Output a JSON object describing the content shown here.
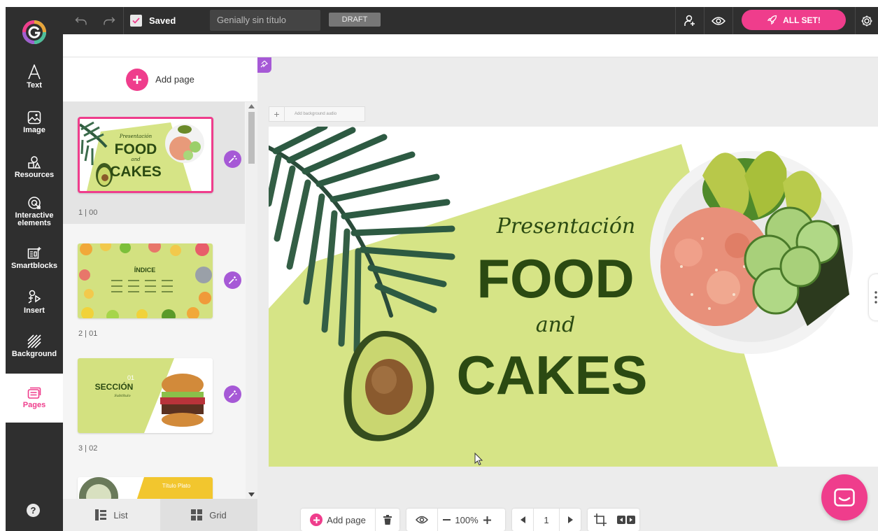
{
  "topbar": {
    "saved_label": "Saved",
    "doc_title": "Genially sin título",
    "status_badge": "DRAFT",
    "allset_label": "ALL SET!"
  },
  "sidebar": {
    "items": [
      {
        "label": "Text",
        "icon": "text-icon"
      },
      {
        "label": "Image",
        "icon": "image-icon"
      },
      {
        "label": "Resources",
        "icon": "resources-icon"
      },
      {
        "label": "Interactive elements",
        "icon": "interactive-elements-icon"
      },
      {
        "label": "Smartblocks",
        "icon": "smartblocks-icon"
      },
      {
        "label": "Insert",
        "icon": "insert-icon"
      },
      {
        "label": "Background",
        "icon": "background-icon"
      },
      {
        "label": "Pages",
        "icon": "pages-icon"
      }
    ],
    "help_label": "?"
  },
  "pages_panel": {
    "add_page_label": "Add page",
    "pages": [
      {
        "number": "1 | 00",
        "kicker": "Presentación",
        "title_a": "FOOD",
        "joiner": "and",
        "title_b": "CAKES"
      },
      {
        "number": "2 | 01",
        "title": "ÍNDICE"
      },
      {
        "number": "3 | 02",
        "num": "01",
        "title": "SECCIÓN",
        "subtitle": "Subtítulo"
      },
      {
        "title": "Título Plato"
      }
    ],
    "view_list_label": "List",
    "view_grid_label": "Grid"
  },
  "canvas": {
    "bg_audio_label": "Add background audio",
    "slide": {
      "kicker": "Presentación",
      "title_a": "FOOD",
      "joiner": "and",
      "title_b": "CAKES"
    }
  },
  "bottom_toolbar": {
    "add_page_label": "Add page",
    "zoom": "100%",
    "page_number": "1"
  },
  "colors": {
    "accent": "#ef3d8c",
    "magic": "#a659d6",
    "slide_green": "#d6e486",
    "title_green": "#2b4a12",
    "chrome": "#2f2f2f"
  }
}
